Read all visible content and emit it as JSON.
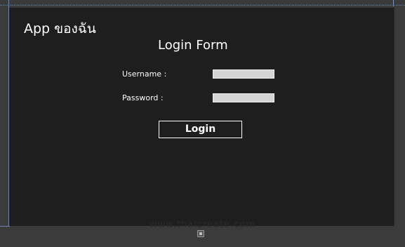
{
  "app": {
    "title": "App ของฉัน"
  },
  "form": {
    "title": "Login Form",
    "username_label": "Username :",
    "username_value": "",
    "password_label": "Password :",
    "password_value": "",
    "login_label": "Login"
  },
  "device": {
    "home_button_icon": "windows-logo-icon",
    "watermark": "www.thaicreate.com"
  },
  "colors": {
    "screen_background": "#1e1e1e",
    "device_frame": "#3b3b3b",
    "text": "#ffffff",
    "textbox": "#d4d4d4"
  }
}
